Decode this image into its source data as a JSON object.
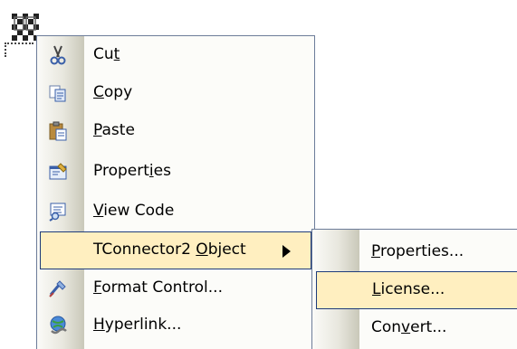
{
  "main_menu": {
    "items": [
      {
        "label_pre": "Cu",
        "label_acc": "t",
        "label_post": "",
        "icon": "scissors-icon"
      },
      {
        "label_pre": "",
        "label_acc": "C",
        "label_post": "opy",
        "icon": "copy-icon"
      },
      {
        "label_pre": "",
        "label_acc": "P",
        "label_post": "aste",
        "icon": "paste-icon"
      },
      {
        "label_pre": "Propert",
        "label_acc": "i",
        "label_post": "es",
        "icon": "properties-icon"
      },
      {
        "label_pre": "",
        "label_acc": "V",
        "label_post": "iew Code",
        "icon": "view-code-icon"
      },
      {
        "label_pre": "TConnector2 ",
        "label_acc": "O",
        "label_post": "bject",
        "icon": ""
      },
      {
        "label_pre": "",
        "label_acc": "F",
        "label_post": "ormat Control...",
        "icon": "format-control-icon"
      },
      {
        "label_pre": "",
        "label_acc": "H",
        "label_post": "yperlink...",
        "icon": "hyperlink-icon"
      }
    ]
  },
  "sub_menu": {
    "items": [
      {
        "label_pre": "",
        "label_acc": "P",
        "label_post": "roperties..."
      },
      {
        "label_pre": "",
        "label_acc": "L",
        "label_post": "icense..."
      },
      {
        "label_pre": "Con",
        "label_acc": "v",
        "label_post": "ert..."
      }
    ]
  },
  "colors": {
    "highlight_fill": "#ffefc0",
    "highlight_border": "#1f3c7a",
    "menu_border": "#6c7c99"
  }
}
